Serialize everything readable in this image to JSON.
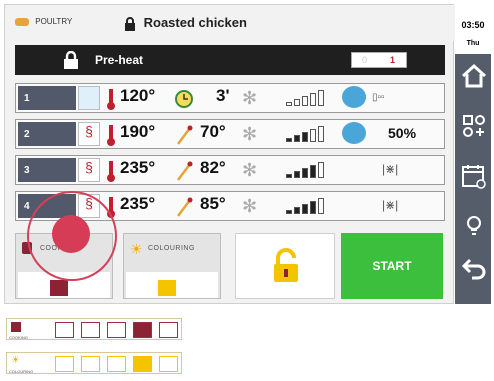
{
  "topbar": {
    "category": "POULTRY",
    "recipe": "Roasted chicken"
  },
  "preheat": {
    "label": "Pre-heat",
    "toggle_off": "0",
    "toggle_on": "1"
  },
  "rows": [
    {
      "num": "1",
      "temp": "120°",
      "core": "3'",
      "extra": "",
      "level": 0.4
    },
    {
      "num": "2",
      "temp": "190°",
      "core": "70°",
      "extra": "50%",
      "level": 0.6
    },
    {
      "num": "3",
      "temp": "235°",
      "core": "82°",
      "extra": "",
      "level": 0.8
    },
    {
      "num": "4",
      "temp": "235°",
      "core": "85°",
      "extra": "",
      "level": 0.8
    }
  ],
  "cooking": {
    "label": "COOKING"
  },
  "colouring": {
    "label": "COLOURING"
  },
  "start_label": "START",
  "clock": {
    "time": "03:50",
    "day": "Thu"
  },
  "legend": {
    "cooking_label": "COOKING",
    "colouring_label": "COLOURING",
    "cooking_level": 4,
    "colouring_level": 4,
    "cells": 5
  },
  "colors": {
    "accent_red": "#8b2335",
    "accent_yellow": "#f5c400",
    "start_green": "#3cbf3c",
    "sidebar": "#555d6b",
    "overlay": "#d63c55"
  },
  "icons": {
    "lock": "lock-icon",
    "thermometer": "thermometer-icon",
    "clock": "clock-icon",
    "probe": "probe-icon",
    "fan": "fan-icon",
    "steam": "steam-icon",
    "home": "home-icon",
    "settings": "settings-icon",
    "calendar": "calendar-icon",
    "bulb": "bulb-icon",
    "back": "back-icon"
  }
}
